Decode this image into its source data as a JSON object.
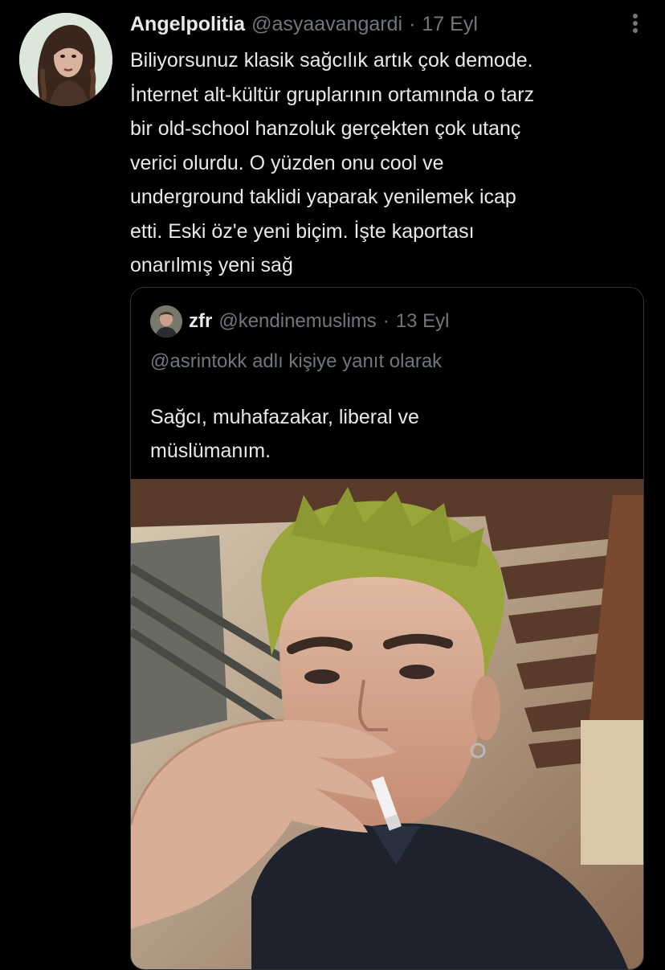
{
  "tweet": {
    "display_name": "Angelpolitia",
    "handle": "@asyaavangardi",
    "separator": "·",
    "date": "17 Eyl",
    "avatar_icon": "profile-photo",
    "more_icon": "more-vertical-icon",
    "text_lines": [
      "Biliyorsunuz klasik sağcılık artık çok demode.",
      "İnternet alt-kültür gruplarının ortamında o tarz",
      "bir old-school hanzoluk gerçekten çok utanç",
      "verici olurdu. O yüzden onu cool ve",
      "underground taklidi yaparak yenilemek icap",
      "etti. Eski öz'e yeni biçim. İşte kaportası",
      "onarılmış yeni sağ"
    ]
  },
  "quoted": {
    "display_name": "zfr",
    "handle": "@kendinemuslims",
    "separator": "·",
    "date": "13 Eyl",
    "reply_context": "@asrintokk adlı kişiye yanıt olarak",
    "text_lines": [
      "Sağcı, muhafazakar, liberal ve",
      "müslümanım."
    ],
    "photo_icon": "attached-photo"
  },
  "colors": {
    "background": "#000000",
    "primary_text": "#e7e9ea",
    "secondary_text": "#71767b",
    "border": "#2f3336"
  }
}
